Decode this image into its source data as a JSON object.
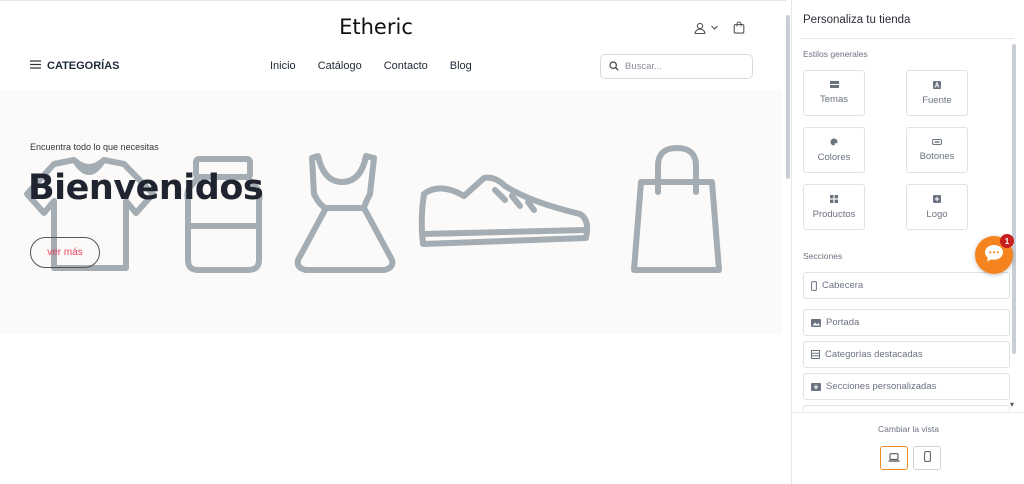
{
  "store": {
    "brand": "Etheric",
    "categories_label": "CATEGORÍAS",
    "nav": [
      "Inicio",
      "Catálogo",
      "Contacto",
      "Blog"
    ],
    "search_placeholder": "Buscar...",
    "icons": {
      "menu": "hamburger-icon",
      "user": "user-icon",
      "chevron": "chevron-down-icon",
      "cart": "shopping-bag-icon",
      "search": "search-icon"
    }
  },
  "hero": {
    "subtitle": "Encuentra todo lo que necesitas",
    "title": "Bienvenidos",
    "button": "ver más",
    "art_icons": [
      "t-shirt-icon",
      "jar-icon",
      "dress-icon",
      "sneaker-icon",
      "shopping-bag-icon"
    ],
    "art_color": "#a3adb3",
    "button_text_color": "#e8445f"
  },
  "panel": {
    "title": "Personaliza tu tienda",
    "general_label": "Estilos generales",
    "tiles": [
      {
        "label": "Temas",
        "icon": "theme-icon"
      },
      {
        "label": "Fuente",
        "icon": "font-icon"
      },
      {
        "label": "Colores",
        "icon": "palette-icon"
      },
      {
        "label": "Botones",
        "icon": "button-icon"
      },
      {
        "label": "Productos",
        "icon": "grid-icon"
      },
      {
        "label": "Logo",
        "icon": "logo-icon"
      }
    ],
    "sections_label": "Secciones",
    "sections": [
      {
        "label": "Cabecera",
        "icon": "mobile-icon"
      },
      {
        "label": "Portada",
        "icon": "image-icon"
      },
      {
        "label": "Categorías destacadas",
        "icon": "list-icon"
      },
      {
        "label": "Secciones personalizadas",
        "icon": "plus-box-icon"
      }
    ],
    "view_label": "Cambiar la vista",
    "views": [
      {
        "name": "desktop",
        "icon": "laptop-icon",
        "active": true
      },
      {
        "name": "mobile",
        "icon": "mobile-icon",
        "active": false
      }
    ],
    "accent_color": "#f08a24"
  },
  "chat": {
    "badge": "1",
    "icon": "chat-bubble-icon",
    "color": "#f5841f"
  }
}
